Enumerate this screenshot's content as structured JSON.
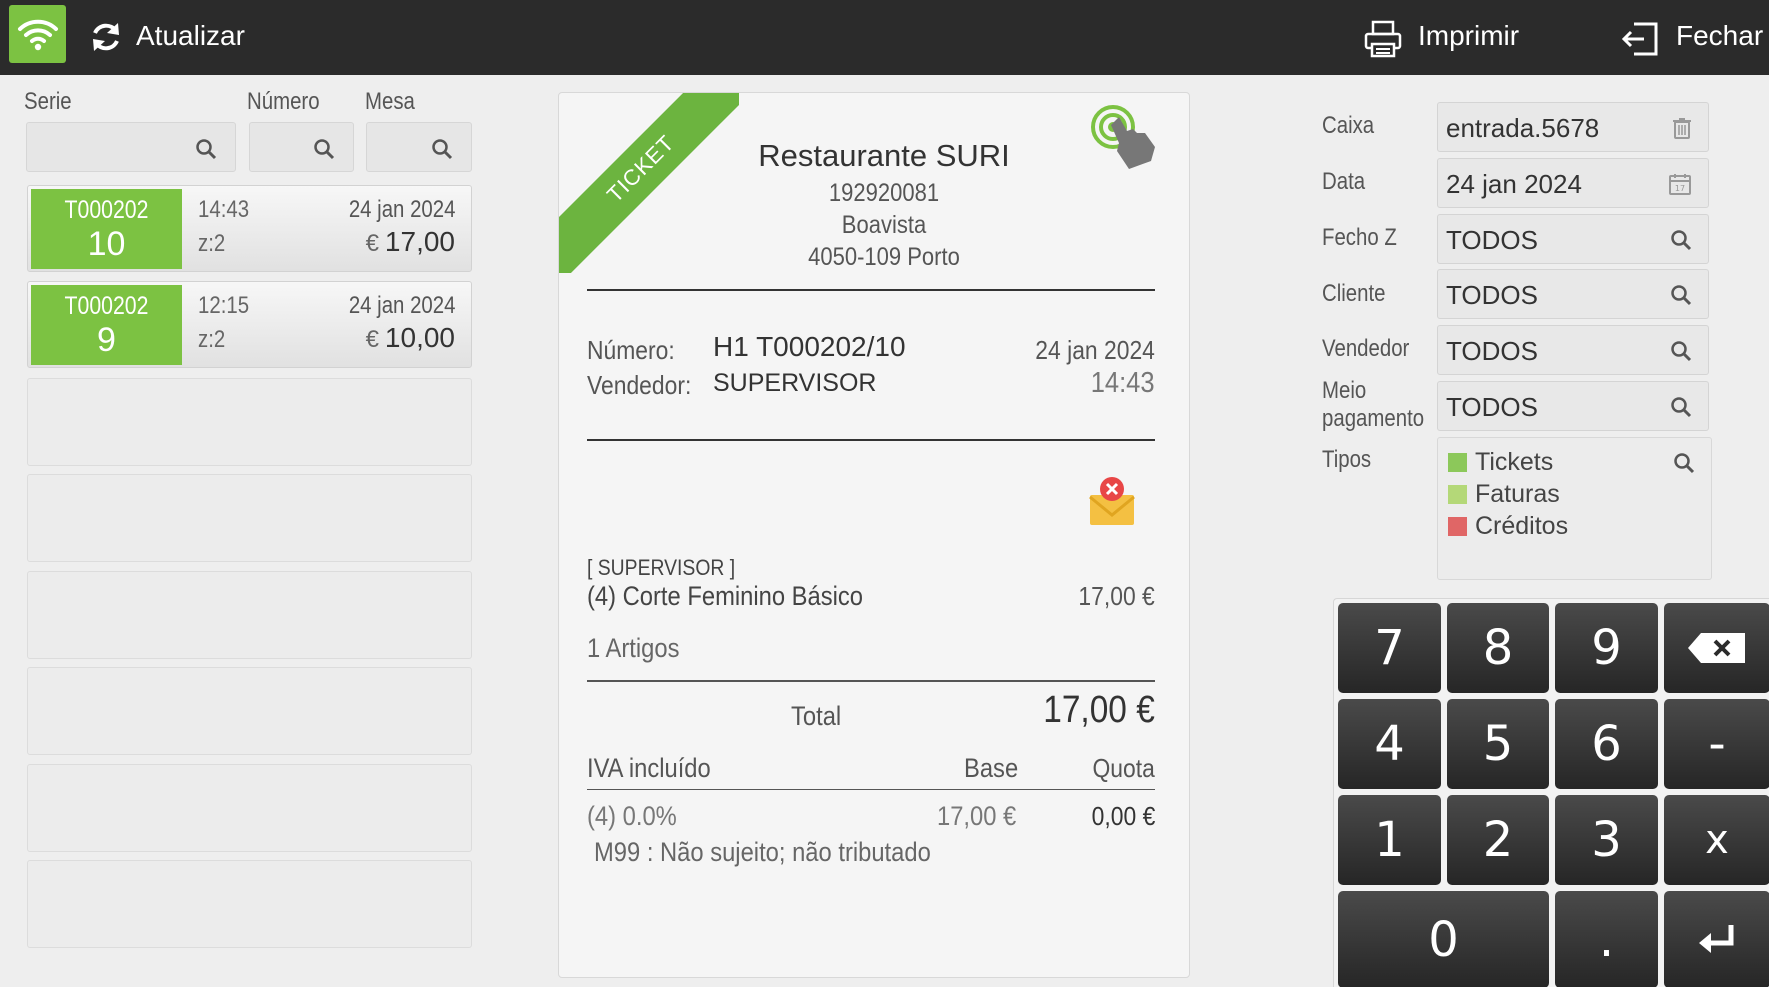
{
  "topbar": {
    "refresh_label": "Atualizar",
    "print_label": "Imprimir",
    "close_label": "Fechar",
    "accent": "#7cc242"
  },
  "filters": {
    "serie_label": "Serie",
    "numero_label": "Número",
    "mesa_label": "Mesa"
  },
  "tickets": [
    {
      "code": "T000202",
      "number": "10",
      "time": "14:43",
      "zone": "z:2",
      "date": "24 jan 2024",
      "currency": "€",
      "amount": "17,00"
    },
    {
      "code": "T000202",
      "number": "9",
      "time": "12:15",
      "zone": "z:2",
      "date": "24 jan 2024",
      "currency": "€",
      "amount": "10,00"
    }
  ],
  "receipt": {
    "ribbon": "TICKET",
    "name": "Restaurante SURI",
    "nif": "192920081",
    "address1": "Boavista",
    "address2": "4050-109 Porto",
    "numero_label": "Número:",
    "numero_value": "H1 T000202/10",
    "date": "24 jan 2024",
    "vendedor_label": "Vendedor:",
    "vendedor_value": "SUPERVISOR",
    "time": "14:43",
    "seller_tag": "[ SUPERVISOR ]",
    "item_name": "(4) Corte Feminino Básico",
    "item_price": "17,00 €",
    "items_count": "1 Artigos",
    "total_label": "Total",
    "total_value": "17,00 €",
    "iva_label": "IVA incluído",
    "base_label": "Base",
    "quota_label": "Quota",
    "iva_rate": "(4) 0.0%",
    "iva_base": "17,00 €",
    "iva_quota": "0,00 €",
    "iva_note": "M99 : Não sujeito; não tributado"
  },
  "right_filters": {
    "caixa_label": "Caixa",
    "caixa_value": "entrada.5678",
    "data_label": "Data",
    "data_value": "24 jan 2024",
    "fechoz_label": "Fecho Z",
    "fechoz_value": "TODOS",
    "cliente_label": "Cliente",
    "cliente_value": "TODOS",
    "vendedor_label": "Vendedor",
    "vendedor_value": "TODOS",
    "meio_label_1": "Meio",
    "meio_label_2": "pagamento",
    "meio_value": "TODOS",
    "tipos_label": "Tipos",
    "tipos": [
      {
        "label": "Tickets",
        "color": "#8cc85a"
      },
      {
        "label": "Faturas",
        "color": "#b4d878"
      },
      {
        "label": "Créditos",
        "color": "#e06666"
      }
    ]
  },
  "keypad": {
    "k7": "7",
    "k8": "8",
    "k9": "9",
    "k4": "4",
    "k5": "5",
    "k6": "6",
    "minus": "-",
    "k1": "1",
    "k2": "2",
    "k3": "3",
    "times": "x",
    "k0": "0",
    "dot": ".",
    "backspace_icon": "backspace-icon",
    "enter_icon": "enter-icon"
  }
}
